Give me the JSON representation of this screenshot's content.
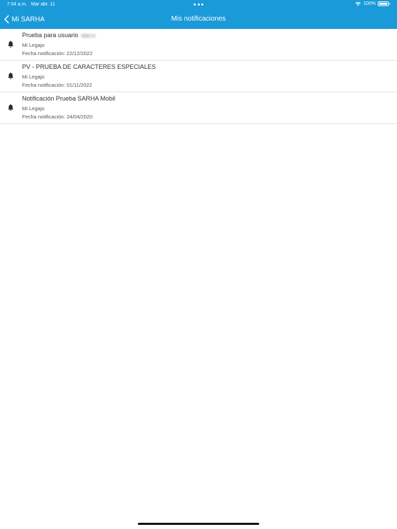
{
  "status_bar": {
    "time": "7:34 a.m.",
    "date": "Mar abr. 11",
    "battery": "100%",
    "battery_level": 1.0,
    "wifi_icon": "wifi-icon",
    "battery_icon": "battery-icon"
  },
  "nav": {
    "back_label": "Mi SARHA",
    "back_icon": "chevron-left-icon",
    "title": "Mis notificaciones"
  },
  "colors": {
    "header_bg": "#1a9ad9",
    "header_text": "#ffffff",
    "divider": "#e3e3e3",
    "title_text": "#333333",
    "meta_text": "#555555"
  },
  "notifications": [
    {
      "icon": "bell-icon",
      "title": "Prueba para usuario",
      "title_redacted": true,
      "source": "Mi Legajo",
      "date": "Fecha notificación: 22/12/2022"
    },
    {
      "icon": "bell-icon",
      "title": "PV - PRUEBA DE CARACTERES ESPECIALES",
      "title_redacted": false,
      "source": "Mi Legajo",
      "date": "Fecha notificación: 01/11/2022"
    },
    {
      "icon": "bell-icon",
      "title": "Notificación Prueba SARHA Mobil",
      "title_redacted": false,
      "source": "Mi Legajo",
      "date": "Fecha notificación: 24/04/2020"
    }
  ]
}
